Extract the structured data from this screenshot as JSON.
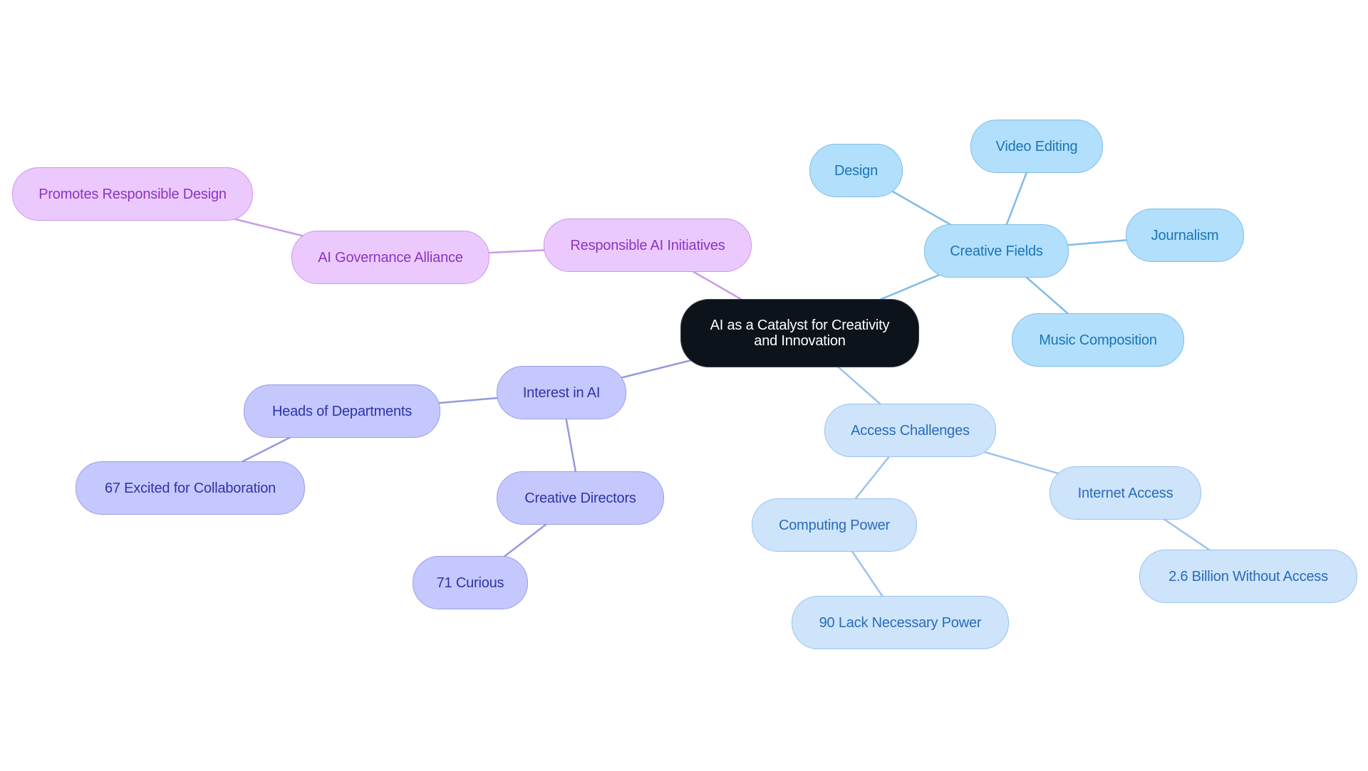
{
  "diagram": {
    "type": "mind-map",
    "colors": {
      "root_fill": "#0d131b",
      "root_text": "#ffffff",
      "purple_fill": "#ebc9fd",
      "purple_text": "#8b35c0",
      "purple_line": "#c99be6",
      "indigo_fill": "#c5c8fd",
      "indigo_text": "#2f33a8",
      "indigo_line": "#9599e0",
      "sky_fill": "#b2dffc",
      "sky_text": "#1b75b5",
      "sky_line": "#7fbde6",
      "lightblue_fill": "#cde4fb",
      "lightblue_text": "#2a6bb8",
      "lightblue_line": "#9cc3ee"
    },
    "root": {
      "label": "AI as a Catalyst for Creativity and Innovation"
    },
    "nodes": {
      "responsible_ai": {
        "label": "Responsible AI Initiatives",
        "parent": "root",
        "theme": "purple"
      },
      "governance": {
        "label": "AI Governance Alliance",
        "parent": "responsible_ai",
        "theme": "purple"
      },
      "promotes": {
        "label": "Promotes Responsible Design",
        "parent": "governance",
        "theme": "purple"
      },
      "creative_fields": {
        "label": "Creative Fields",
        "parent": "root",
        "theme": "sky"
      },
      "design": {
        "label": "Design",
        "parent": "creative_fields",
        "theme": "sky"
      },
      "video_editing": {
        "label": "Video Editing",
        "parent": "creative_fields",
        "theme": "sky"
      },
      "journalism": {
        "label": "Journalism",
        "parent": "creative_fields",
        "theme": "sky"
      },
      "music": {
        "label": "Music Composition",
        "parent": "creative_fields",
        "theme": "sky"
      },
      "access": {
        "label": "Access Challenges",
        "parent": "root",
        "theme": "lightblue"
      },
      "computing": {
        "label": "Computing Power",
        "parent": "access",
        "theme": "lightblue"
      },
      "lack_power": {
        "label": "90 Lack Necessary Power",
        "parent": "computing",
        "theme": "lightblue"
      },
      "internet": {
        "label": "Internet Access",
        "parent": "access",
        "theme": "lightblue"
      },
      "billion": {
        "label": "2.6 Billion Without Access",
        "parent": "internet",
        "theme": "lightblue"
      },
      "interest": {
        "label": "Interest in AI",
        "parent": "root",
        "theme": "indigo"
      },
      "heads": {
        "label": "Heads of Departments",
        "parent": "interest",
        "theme": "indigo"
      },
      "excited": {
        "label": "67 Excited for Collaboration",
        "parent": "heads",
        "theme": "indigo"
      },
      "directors": {
        "label": "Creative Directors",
        "parent": "interest",
        "theme": "indigo"
      },
      "curious": {
        "label": "71 Curious",
        "parent": "directors",
        "theme": "indigo"
      }
    }
  }
}
